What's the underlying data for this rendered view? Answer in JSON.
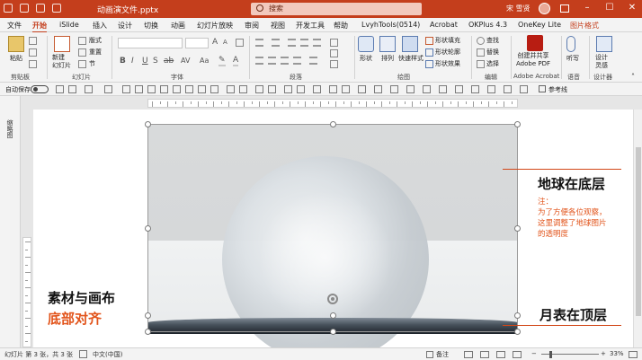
{
  "titlebar": {
    "document_title": "动画演文件.pptx",
    "search_placeholder": "搜索",
    "user_name": "宋 雪贤"
  },
  "tabs": [
    "文件",
    "开始",
    "iSlide",
    "插入",
    "设计",
    "切换",
    "动画",
    "幻灯片放映",
    "审阅",
    "视图",
    "开发工具",
    "帮助",
    "LvyhTools(0514)",
    "Acrobat",
    "OKPlus 4.3",
    "OneKey Lite",
    "图片格式"
  ],
  "active_tab": "开始",
  "ribbon": {
    "clipboard": {
      "paste": "粘贴",
      "group": "剪贴板"
    },
    "slides": {
      "new_slide": "新建\n幻灯片",
      "layout": "版式",
      "reset": "重置",
      "section": "节",
      "group": "幻灯片"
    },
    "font": {
      "group": "字体",
      "format_buttons": [
        "B",
        "I",
        "U",
        "S",
        "ab",
        "AV",
        "Aa"
      ]
    },
    "paragraph": {
      "group": "段落"
    },
    "drawing": {
      "shapes": "形状",
      "arrange": "排列",
      "quick_styles": "快速样式",
      "fill": "形状填充",
      "outline": "形状轮廓",
      "effects": "形状效果",
      "group": "绘图"
    },
    "editing": {
      "find": "查找",
      "replace": "替换",
      "select": "选择",
      "group": "编辑"
    },
    "acrobat": {
      "create_share": "创建并共享\nAdobe PDF",
      "group": "Adobe Acrobat"
    },
    "voice": {
      "dictate": "听写",
      "group": "语音"
    },
    "designer": {
      "design_ideas": "设计\n灵感",
      "group": "设计器"
    }
  },
  "quickbar": {
    "autosave": "自动保存",
    "guides": "参考线"
  },
  "left_panel": {
    "label": "缩略图"
  },
  "slide": {
    "label_earth": "地球在底层",
    "note": "注：\n为了方便各位观察，\n这里调整了地球图片\n的透明度",
    "label_moon": "月表在顶层",
    "label_align_line1": "素材与画布",
    "label_align_line2": "底部对齐"
  },
  "status": {
    "slide_info": "幻灯片 第 3 张，共 3 张",
    "language": "中文(中国)",
    "notes": "备注",
    "zoom": "33%"
  },
  "colors": {
    "accent": "#c43e1c",
    "annotation": "#e2541b"
  }
}
